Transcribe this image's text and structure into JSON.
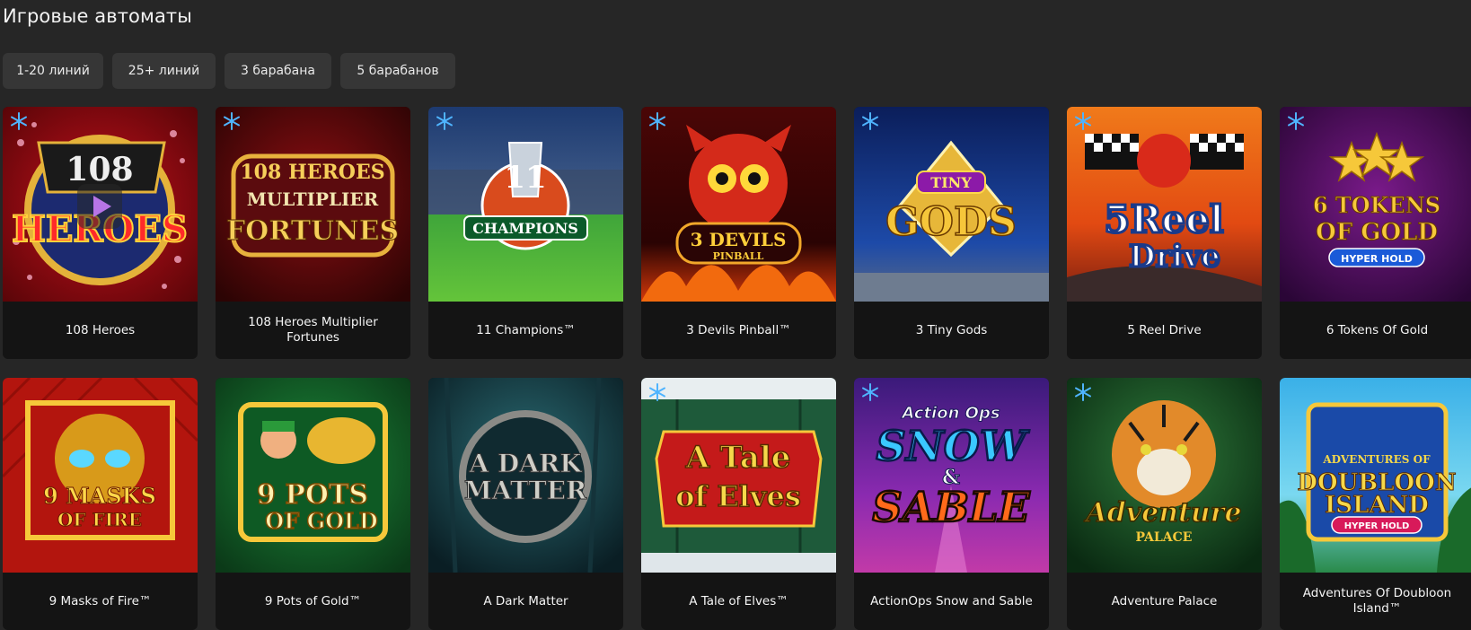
{
  "page": {
    "title": "Игровые автоматы"
  },
  "filters": [
    {
      "label": "1-20 линий"
    },
    {
      "label": "25+ линий"
    },
    {
      "label": "3 барабана"
    },
    {
      "label": "5 барабанов"
    }
  ],
  "colors": {
    "background": "#262626",
    "card": "#141414",
    "filter": "#363636",
    "snowflake": "#4fb4ff",
    "play": "#b774e6"
  },
  "games": [
    {
      "title": "108 Heroes",
      "logo": [
        "108",
        "HEROES"
      ],
      "snow": true,
      "play": true
    },
    {
      "title": "108 Heroes Multiplier Fortunes",
      "logo": [
        "108 HEROES",
        "MULTIPLIER",
        "FORTUNES"
      ],
      "snow": true
    },
    {
      "title": "11 Champions™",
      "logo": [
        "11",
        "CHAMPIONS"
      ],
      "snow": true
    },
    {
      "title": "3 Devils Pinball™",
      "logo": [
        "3 DEVILS",
        "PINBALL"
      ],
      "snow": true
    },
    {
      "title": "3 Tiny Gods",
      "logo": [
        "TINY",
        "GODS"
      ],
      "snow": true
    },
    {
      "title": "5 Reel Drive",
      "logo": [
        "5Reel",
        "Drive"
      ],
      "snow": true
    },
    {
      "title": "6 Tokens Of Gold",
      "logo": [
        "6 TOKENS",
        "OF GOLD",
        "HYPER HOLD"
      ],
      "snow": true
    },
    {
      "title": "9 Masks of Fire™",
      "logo": [
        "9 MASKS",
        "OF FIRE"
      ],
      "snow": false
    },
    {
      "title": "9 Pots of Gold™",
      "logo": [
        "9 POTS",
        "OF GOLD"
      ],
      "snow": false
    },
    {
      "title": "A Dark Matter",
      "logo": [
        "A DARK",
        "MATTER"
      ],
      "snow": false
    },
    {
      "title": "A Tale of Elves™",
      "logo": [
        "A Tale",
        "of Elves"
      ],
      "snow": true
    },
    {
      "title": "ActionOps Snow and Sable",
      "logo": [
        "Action Ops",
        "SNOW",
        "SABLE"
      ],
      "snow": true
    },
    {
      "title": "Adventure Palace",
      "logo": [
        "Adventure",
        "PALACE"
      ],
      "snow": true
    },
    {
      "title": "Adventures Of Doubloon Island™",
      "logo": [
        "ADVENTURES OF",
        "DOUBLOON",
        "ISLAND",
        "HYPER HOLD"
      ],
      "snow": false
    }
  ]
}
